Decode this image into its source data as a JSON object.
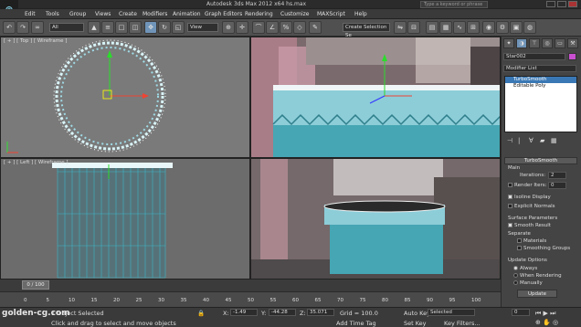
{
  "titlebar": {
    "title": "Autodesk 3ds Max  2012 x64      hs.max",
    "search_placeholder": "Type a keyword or phrase"
  },
  "menubar": {
    "items": [
      "Edit",
      "Tools",
      "Group",
      "Views",
      "Create",
      "Modifiers",
      "Animation",
      "Graph Editors",
      "Rendering",
      "Customize",
      "MAXScript",
      "Help"
    ]
  },
  "toolbar": {
    "filter_value": "All",
    "ref_coord": "View",
    "selection_set": "Create Selection Se"
  },
  "viewports": {
    "top_label": "[ + ] [ Top ] [ Wireframe ]",
    "left_label": "[ + ] [ Left ] [ Wireframe ]"
  },
  "command_panel": {
    "object_name": "Star002",
    "modifier_list": "Modifier List",
    "stack": [
      "TurboSmooth",
      "Editable Poly"
    ],
    "rollout_title": "TurboSmooth",
    "main_label": "Main",
    "iterations_label": "Iterations:",
    "iterations_value": "2",
    "render_iters_label": "Render Iters:",
    "render_iters_value": "0",
    "isoline_label": "Isoline Display",
    "explicit_label": "Explicit Normals",
    "surface_label": "Surface Parameters",
    "smooth_label": "Smooth Result",
    "separate_label": "Separate",
    "materials_label": "Materials",
    "smoothing_label": "Smoothing Groups",
    "update_label": "Update Options",
    "always_label": "Always",
    "when_render_label": "When Rendering",
    "manually_label": "Manually",
    "update_button": "Update"
  },
  "timeline": {
    "frame_display": "0 / 100",
    "ticks": [
      "0",
      "5",
      "10",
      "15",
      "20",
      "25",
      "30",
      "35",
      "40",
      "45",
      "50",
      "55",
      "60",
      "65",
      "70",
      "75",
      "80",
      "85",
      "90",
      "95",
      "100"
    ]
  },
  "status": {
    "selected": "1 Object Selected",
    "prompt": "Click and drag to select and move objects",
    "x_label": "X:",
    "x_value": "-1.49",
    "y_label": "Y:",
    "y_value": "-44.28",
    "z_label": "Z:",
    "z_value": "35.071",
    "grid": "Grid = 100.0",
    "add_time_tag": "Add Time Tag",
    "auto_key": "Auto Key",
    "set_key": "Set Key",
    "selected_dd": "Selected",
    "key_filters": "Key Filters...",
    "frame_value": "0"
  },
  "watermark": "golden-cg.com",
  "colors": {
    "accent": "#6f94b8",
    "teal_object": "#5fb3c3",
    "wire": "#3fb6c8"
  }
}
